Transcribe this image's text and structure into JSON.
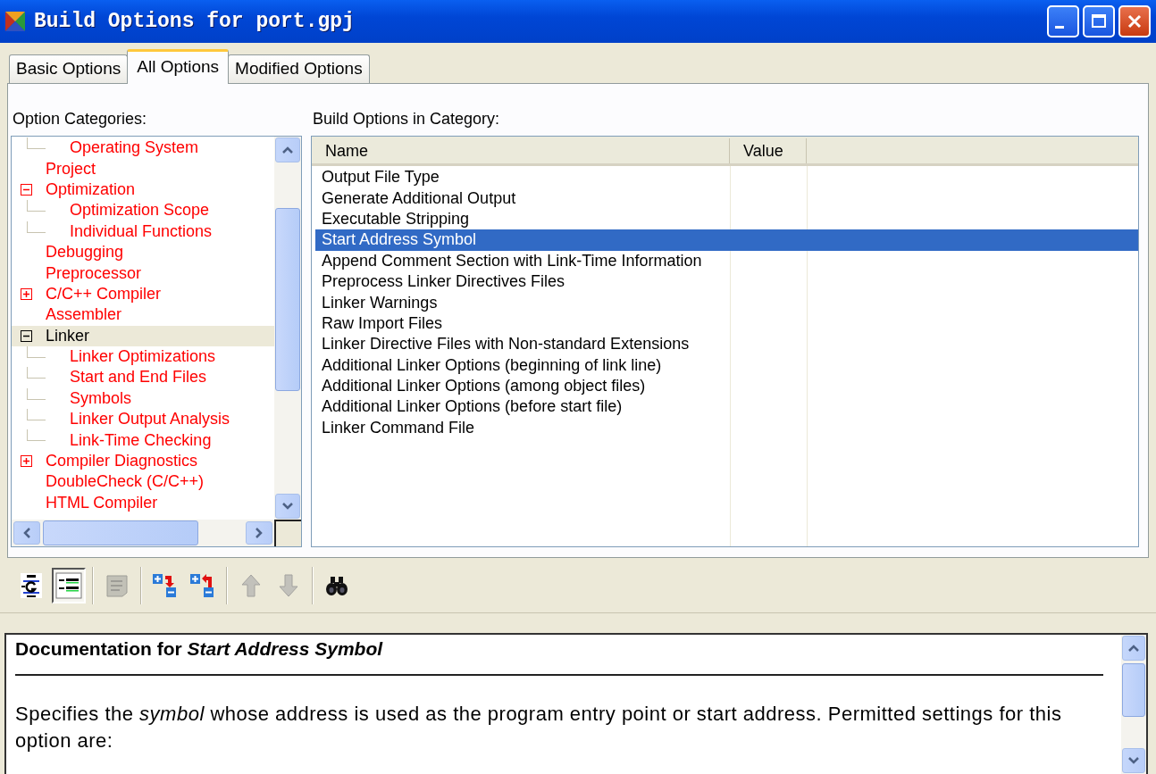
{
  "window": {
    "title": "Build Options for port.gpj"
  },
  "tabs": [
    {
      "label": "Basic Options",
      "selected": false
    },
    {
      "label": "All Options",
      "selected": true
    },
    {
      "label": "Modified Options",
      "selected": false
    }
  ],
  "categories": {
    "label": "Option Categories:",
    "items": [
      {
        "children": [
          {
            "label": "Operating System",
            "selected": false
          }
        ]
      },
      {
        "label": "Project",
        "selected": false
      },
      {
        "label": "Optimization",
        "selected": false,
        "expanded": true,
        "children": [
          {
            "label": "Optimization Scope",
            "selected": false
          },
          {
            "label": "Individual Functions",
            "selected": false
          }
        ]
      },
      {
        "label": "Debugging",
        "selected": false
      },
      {
        "label": "Preprocessor",
        "selected": false
      },
      {
        "label": "C/C++ Compiler",
        "selected": false,
        "expanded": false
      },
      {
        "label": "Assembler",
        "selected": false
      },
      {
        "label": "Linker",
        "selected": true,
        "expanded": true,
        "children": [
          {
            "label": "Linker Optimizations",
            "selected": false
          },
          {
            "label": "Start and End Files",
            "selected": false
          },
          {
            "label": "Symbols",
            "selected": false
          },
          {
            "label": "Linker Output Analysis",
            "selected": false
          },
          {
            "label": "Link-Time Checking",
            "selected": false
          }
        ]
      },
      {
        "label": "Compiler Diagnostics",
        "selected": false,
        "expanded": false
      },
      {
        "label": "DoubleCheck (C/C++)",
        "selected": false
      },
      {
        "label": "HTML Compiler",
        "selected": false
      }
    ]
  },
  "options": {
    "label": "Build Options in Category:",
    "columns": [
      "Name",
      "Value"
    ],
    "rows": [
      {
        "name": "Output File Type",
        "selected": false
      },
      {
        "name": "Generate Additional Output",
        "selected": false
      },
      {
        "name": "Executable Stripping",
        "selected": false
      },
      {
        "name": "Start Address Symbol",
        "selected": true
      },
      {
        "name": "Append Comment Section with Link-Time Information",
        "selected": false
      },
      {
        "name": "Preprocess Linker Directives Files",
        "selected": false
      },
      {
        "name": "Linker Warnings",
        "selected": false
      },
      {
        "name": "Raw Import Files",
        "selected": false
      },
      {
        "name": "Linker Directive Files with Non-standard Extensions",
        "selected": false
      },
      {
        "name": "Additional Linker Options (beginning of link line)",
        "selected": false
      },
      {
        "name": "Additional Linker Options (among object files)",
        "selected": false
      },
      {
        "name": "Additional Linker Options (before start file)",
        "selected": false
      },
      {
        "name": "Linker Command File",
        "selected": false
      }
    ]
  },
  "toolbar": [
    {
      "kind": "text-view",
      "selected": false,
      "disabled": false
    },
    {
      "kind": "list-view",
      "selected": true,
      "disabled": false
    },
    {
      "kind": "separator"
    },
    {
      "kind": "notes",
      "selected": false,
      "disabled": true
    },
    {
      "kind": "separator"
    },
    {
      "kind": "expand",
      "selected": false,
      "disabled": false
    },
    {
      "kind": "collapse",
      "selected": false,
      "disabled": false
    },
    {
      "kind": "separator"
    },
    {
      "kind": "up",
      "selected": false,
      "disabled": true
    },
    {
      "kind": "down",
      "selected": false,
      "disabled": true
    },
    {
      "kind": "separator"
    },
    {
      "kind": "find",
      "selected": false,
      "disabled": false
    }
  ],
  "documentation": {
    "title": "Documentation for *Start Address Symbol*",
    "text": "Specifies the *symbol* whose address is used as the program entry point or start address. Permitted settings for this option are:"
  }
}
